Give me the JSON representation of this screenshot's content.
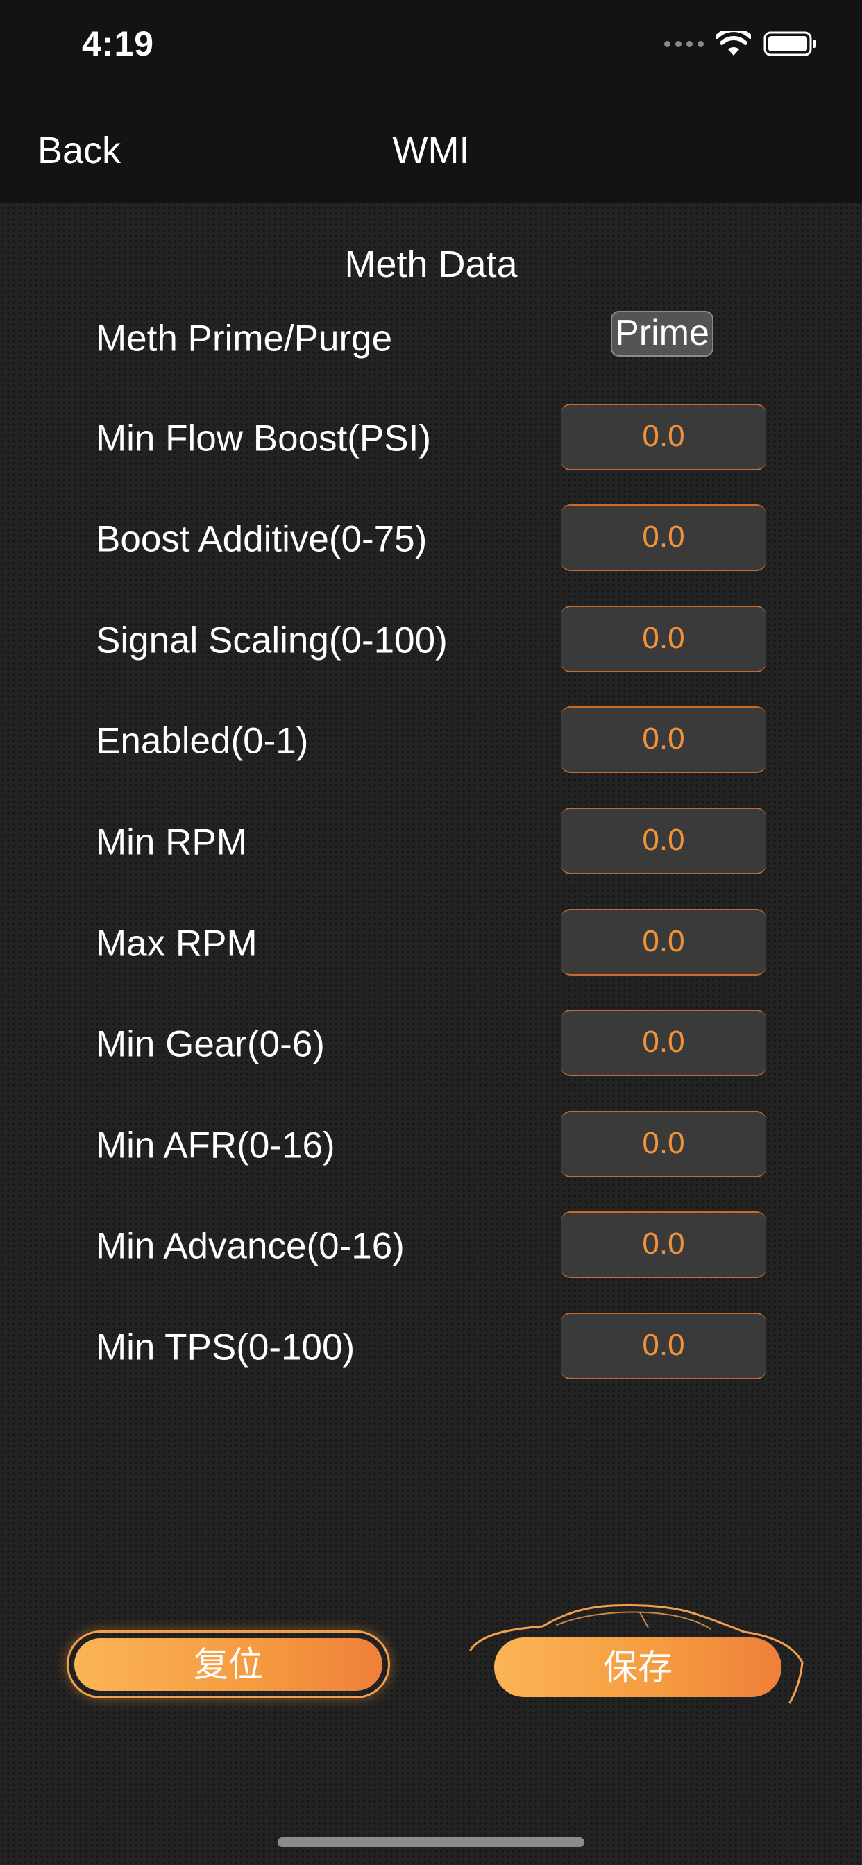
{
  "status_bar": {
    "time": "4:19"
  },
  "nav": {
    "back_label": "Back",
    "title": "WMI"
  },
  "section_title": "Meth Data",
  "prime_row": {
    "label": "Meth Prime/Purge",
    "button_label": "Prime"
  },
  "fields": [
    {
      "label": "Min Flow Boost(PSI)",
      "value": "0.0"
    },
    {
      "label": "Boost Additive(0-75)",
      "value": "0.0"
    },
    {
      "label": "Signal Scaling(0-100)",
      "value": "0.0"
    },
    {
      "label": "Enabled(0-1)",
      "value": "0.0"
    },
    {
      "label": "Min RPM",
      "value": "0.0"
    },
    {
      "label": "Max RPM",
      "value": "0.0"
    },
    {
      "label": "Min Gear(0-6)",
      "value": "0.0"
    },
    {
      "label": "Min AFR(0-16)",
      "value": "0.0"
    },
    {
      "label": "Min Advance(0-16)",
      "value": "0.0"
    },
    {
      "label": "Min TPS(0-100)",
      "value": "0.0"
    }
  ],
  "buttons": {
    "reset_label": "复位",
    "save_label": "保存"
  },
  "colors": {
    "accent": "#f59a40",
    "value_text": "#f0913c",
    "background": "#232323",
    "topbar": "#131313"
  }
}
